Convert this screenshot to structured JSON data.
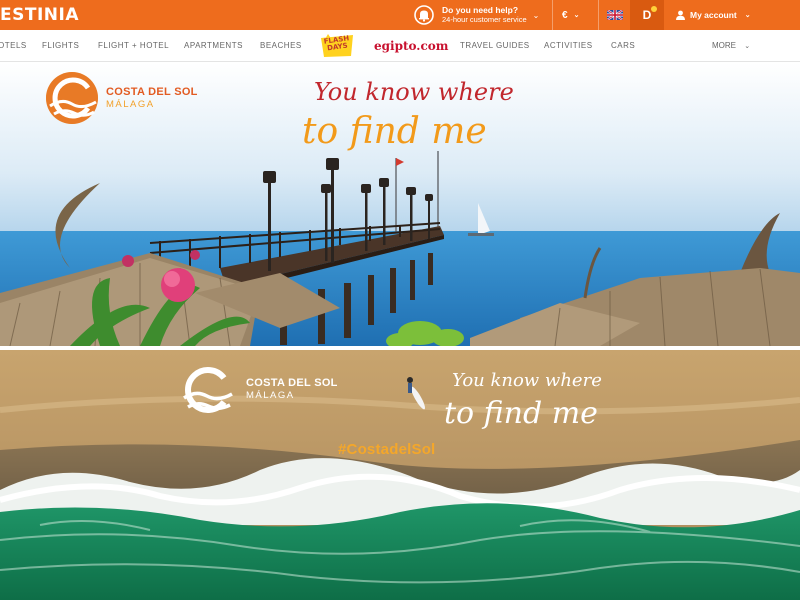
{
  "header": {
    "brand": "ESTINIA",
    "help": {
      "title": "Do you need help?",
      "subtitle": "24-hour customer service"
    },
    "currency": "€",
    "profile_initial": "D",
    "account_label": "My account"
  },
  "nav": {
    "items": [
      "OTELS",
      "FLIGHTS",
      "FLIGHT + HOTEL",
      "APARTMENTS",
      "BEACHES"
    ],
    "flash_logo": "FLASH DAYS",
    "partner": "egipto.com",
    "items_right": [
      "TRAVEL GUIDES",
      "ACTIVITIES",
      "CARS"
    ],
    "more": "MORE"
  },
  "banner_top": {
    "brand_name": "COSTA DEL SOL",
    "brand_city": "MÁLAGA",
    "slogan_line1": "You know where",
    "slogan_line2": "to find me"
  },
  "banner_bottom": {
    "brand_name": "COSTA DEL SOL",
    "brand_city": "MÁLAGA",
    "slogan_line1": "You know where",
    "slogan_line2": "to find me",
    "hashtag": "#CostadelSol"
  },
  "colors": {
    "header_orange": "#ee6c1d",
    "brand_orange": "#e25b22",
    "brand_gold": "#f2a12b",
    "slogan_red": "#c1272d",
    "hashtag_gold": "#f4a72a"
  },
  "icons": [
    "bell-help-icon",
    "chevron-down-icon",
    "uk-flag-icon",
    "user-icon",
    "costa-del-sol-logo"
  ]
}
